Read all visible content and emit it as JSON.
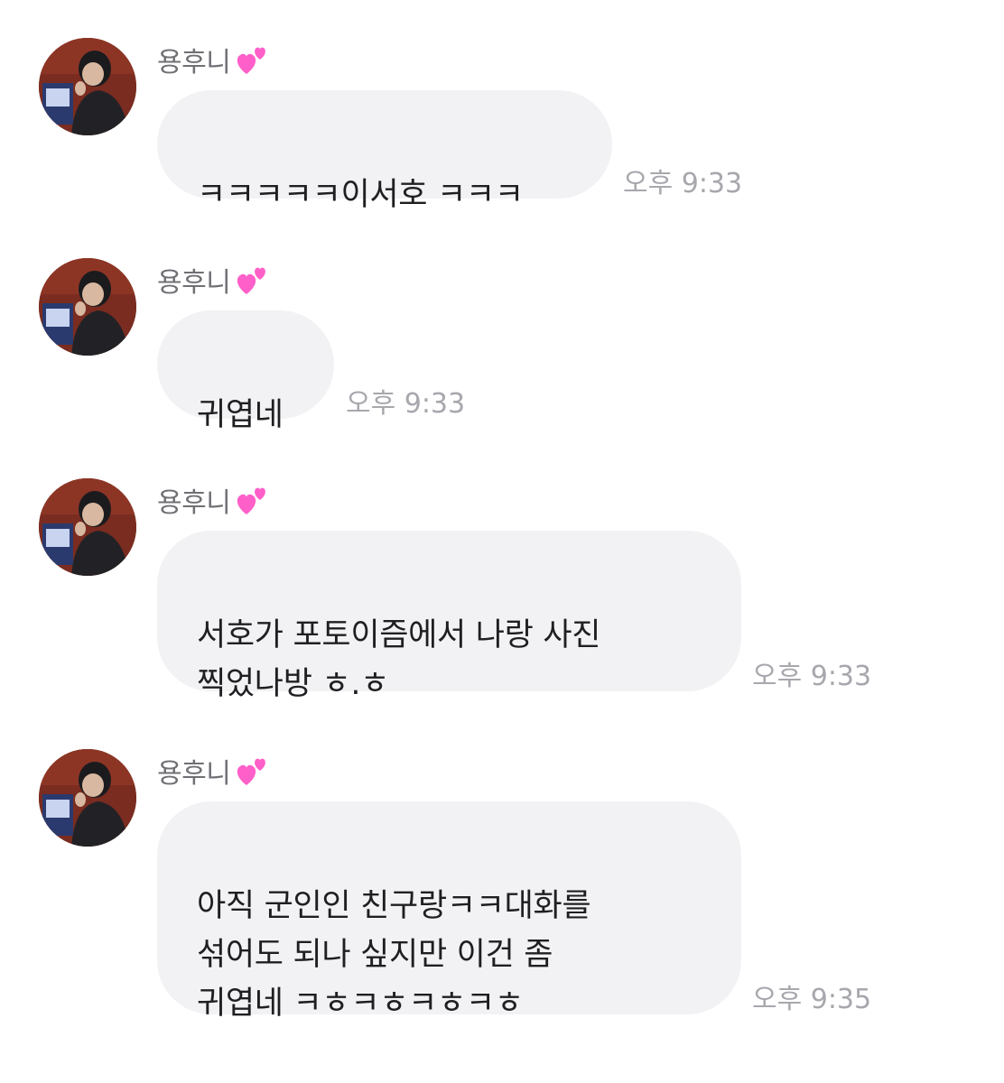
{
  "messages": [
    {
      "sender": "용후니",
      "text": "ㅋㅋㅋㅋㅋ이서호 ㅋㅋㅋ",
      "time": "오후 9:33"
    },
    {
      "sender": "용후니",
      "text": "귀엽네",
      "time": "오후 9:33"
    },
    {
      "sender": "용후니",
      "text": "서호가 포토이즘에서 나랑 사진\n찍었나방 ㅎ.ㅎ",
      "time": "오후 9:33"
    },
    {
      "sender": "용후니",
      "text": "아직 군인인 친구랑ㅋㅋ대화를\n섞어도 되나 싶지만 이건 좀\n귀엽네 ㅋㅎㅋㅎㅋㅎㅋㅎ",
      "time": "오후 9:35"
    }
  ],
  "icons": {
    "avatar": "profile-photo",
    "heart": "two-hearts-emoji"
  },
  "colors": {
    "bubble": "#f2f2f5",
    "time": "#a7a7ad",
    "sender": "#6f6f74",
    "heart": "#ff5fc8"
  }
}
